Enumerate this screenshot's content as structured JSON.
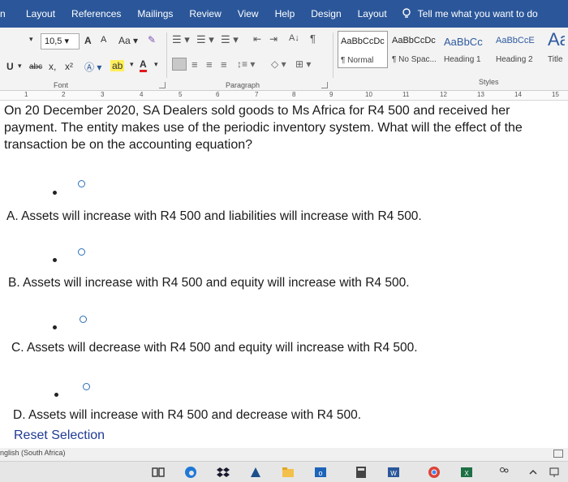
{
  "ribbon_tabs": [
    "n",
    "Layout",
    "References",
    "Mailings",
    "Review",
    "View",
    "Help",
    "Design",
    "Layout"
  ],
  "tell_me": "Tell me what you want to do",
  "font": {
    "size": "10,5",
    "grow_label": "A",
    "shrink_label": "A",
    "case_label": "Aa",
    "sub_label": "x",
    "super_label": "x²",
    "group_label": "Font"
  },
  "paragraph": {
    "group_label": "Paragraph"
  },
  "styles": {
    "group_label": "Styles",
    "items": [
      {
        "sample": "AaBbCcDc",
        "name": "¶ Normal"
      },
      {
        "sample": "AaBbCcDc",
        "name": "¶ No Spac..."
      },
      {
        "sample": "AaBbCc",
        "name": "Heading 1"
      },
      {
        "sample": "AaBbCcE",
        "name": "Heading 2"
      },
      {
        "sample": "Aa",
        "name": "Title"
      }
    ]
  },
  "ruler": [
    "1",
    "2",
    "3",
    "4",
    "5",
    "6",
    "7",
    "8",
    "9",
    "10",
    "11",
    "12",
    "13",
    "14",
    "15"
  ],
  "question": "On 20 December 2020, SA Dealers sold goods to Ms Africa for R4 500 and received her payment. The entity makes use of the periodic inventory system. What will the effect of the transaction be on the accounting equation?",
  "options": [
    "A. Assets will increase with R4 500 and liabilities will increase with R4 500.",
    "B. Assets will increase with R4 500 and equity will increase with R4 500.",
    "C. Assets will decrease with R4 500 and equity will increase with R4 500.",
    "D. Assets will increase with R4 500 and decrease with R4 500."
  ],
  "reset_label": "Reset Selection",
  "status_language": "nglish (South Africa)",
  "colors": {
    "ribbon_blue": "#2b579a",
    "link_blue": "#1f3a93",
    "radio_blue": "#2a6db8"
  }
}
